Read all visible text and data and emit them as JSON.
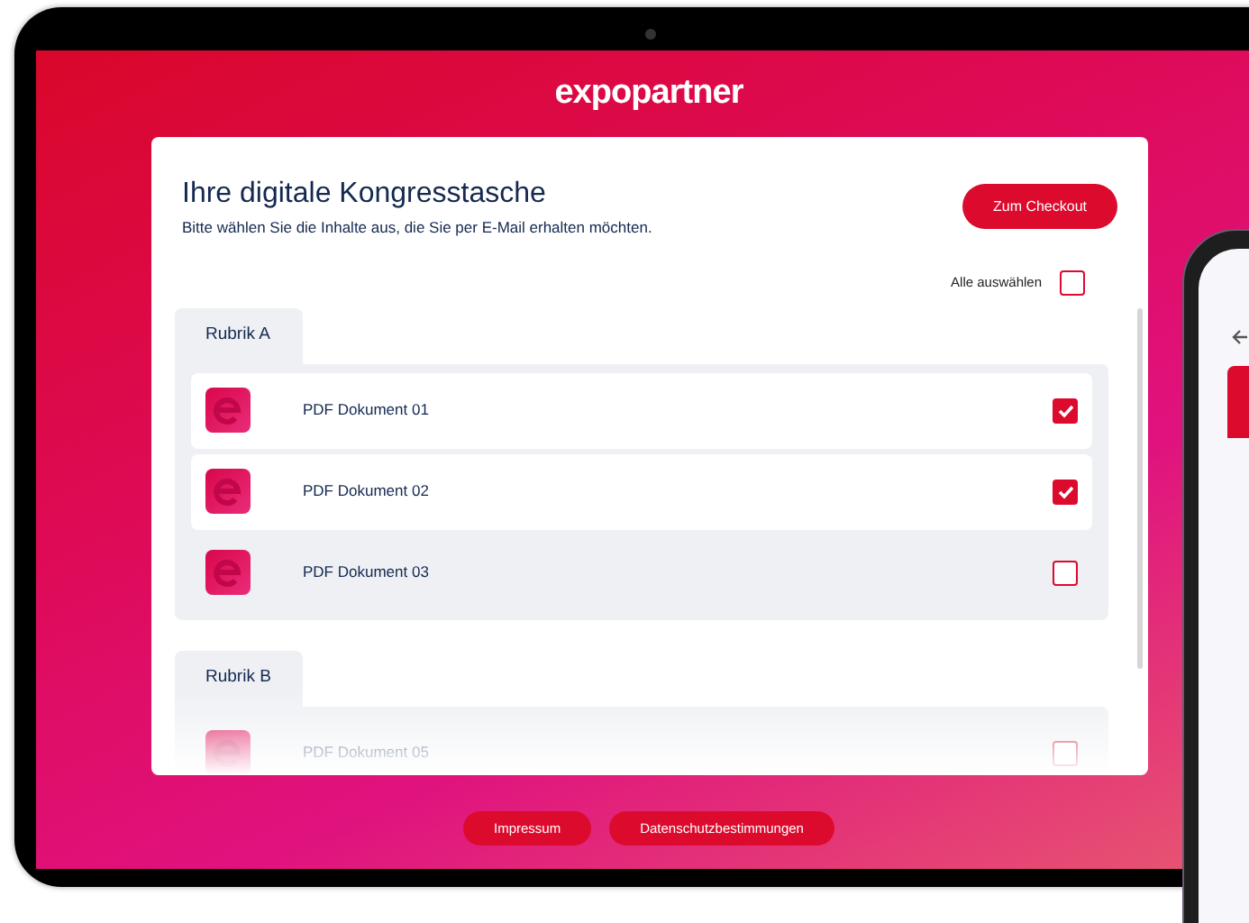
{
  "brand": "expopartner",
  "card": {
    "title": "Ihre digitale Kongresstasche",
    "subtitle": "Bitte wählen Sie die Inhalte aus, die Sie per E-Mail erhalten möchten.",
    "checkout_button": "Zum Checkout"
  },
  "select_all": {
    "label": "Alle auswählen",
    "checked": false
  },
  "sections": [
    {
      "title": "Rubrik A",
      "items": [
        {
          "name": "PDF Dokument 01",
          "checked": true
        },
        {
          "name": "PDF Dokument 02",
          "checked": true
        },
        {
          "name": "PDF Dokument 03",
          "checked": false
        }
      ]
    },
    {
      "title": "Rubrik B",
      "items": [
        {
          "name": "PDF Dokument 05",
          "checked": false
        }
      ]
    }
  ],
  "footer_links": [
    "Impressum",
    "Datenschutzbestimmungen"
  ]
}
